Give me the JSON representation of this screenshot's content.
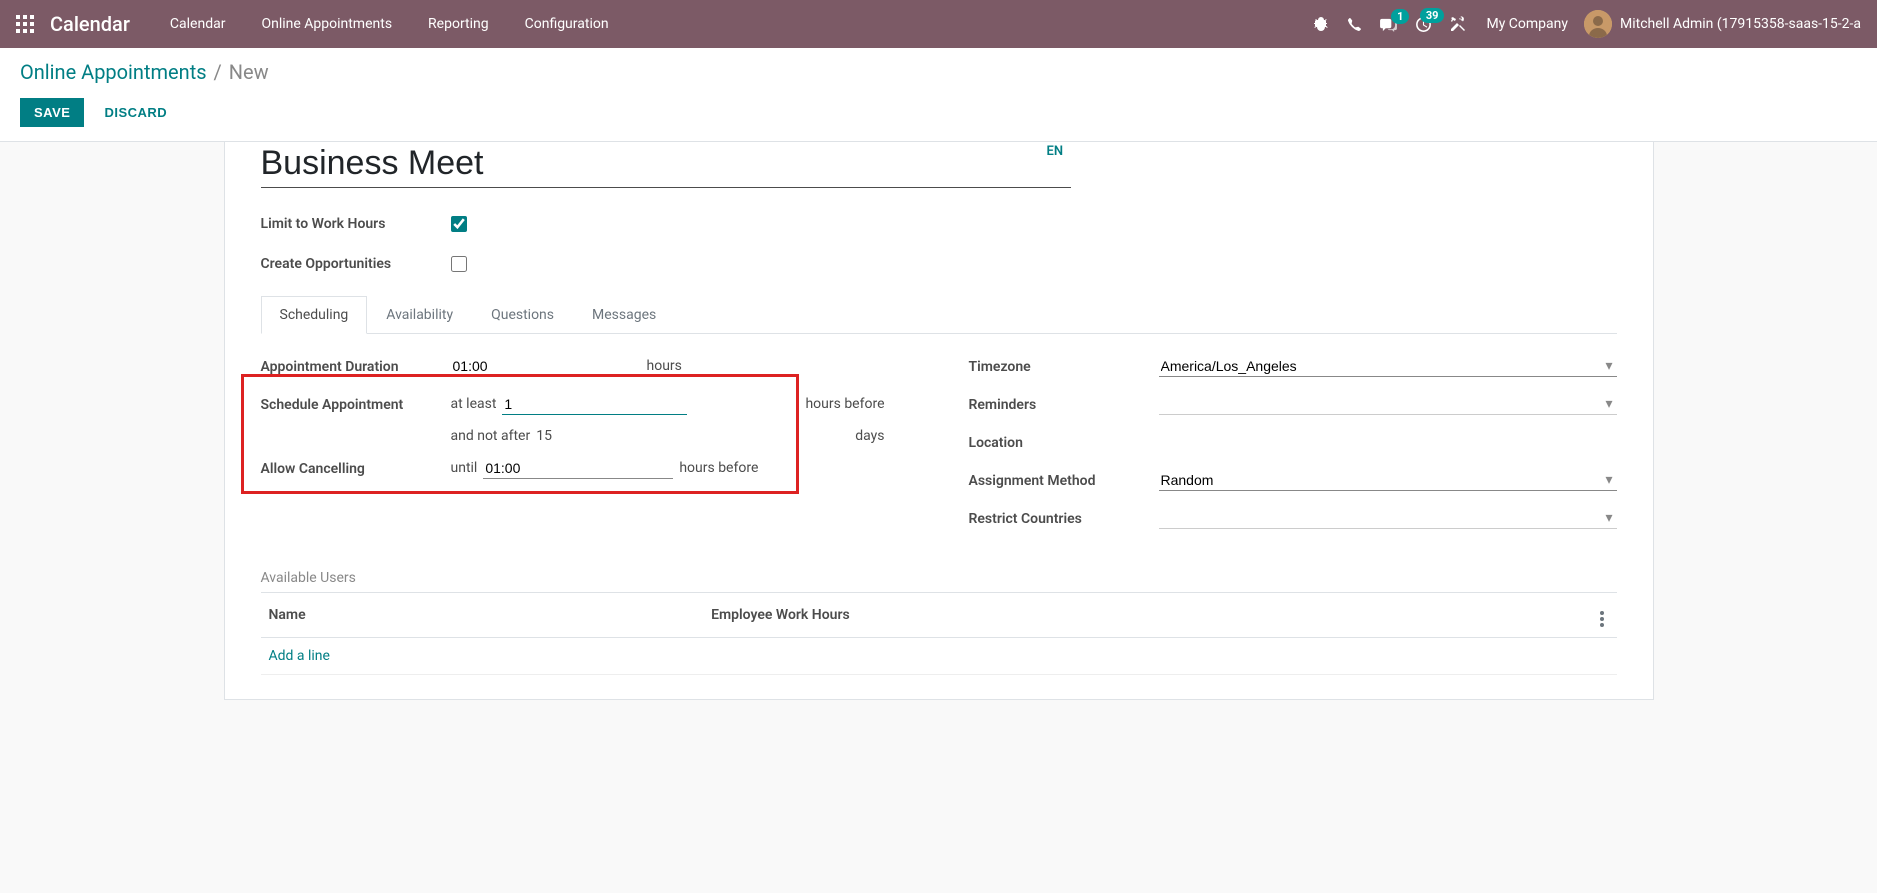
{
  "topnav": {
    "brand": "Calendar",
    "items": [
      "Calendar",
      "Online Appointments",
      "Reporting",
      "Configuration"
    ],
    "chat_badge": "1",
    "activity_badge": "39",
    "company": "My Company",
    "user": "Mitchell Admin (17915358-saas-15-2-a"
  },
  "breadcrumb": {
    "parent": "Online Appointments",
    "current": "New"
  },
  "actions": {
    "save": "SAVE",
    "discard": "DISCARD"
  },
  "form": {
    "name": "Business Meet",
    "lang": "EN",
    "limit_work_hours_label": "Limit to Work Hours",
    "limit_work_hours_checked": true,
    "create_opportunities_label": "Create Opportunities",
    "create_opportunities_checked": false
  },
  "tabs": [
    "Scheduling",
    "Availability",
    "Questions",
    "Messages"
  ],
  "scheduling": {
    "left": {
      "appt_duration_label": "Appointment Duration",
      "appt_duration_value": "01:00",
      "appt_duration_suffix": "hours",
      "schedule_label": "Schedule Appointment",
      "schedule_at_least_prefix": "at least",
      "schedule_at_least_value": "1",
      "schedule_at_least_suffix": "hours before",
      "schedule_not_after_prefix": "and not after",
      "schedule_not_after_value": "15",
      "schedule_not_after_suffix": "days",
      "allow_cancel_label": "Allow Cancelling",
      "allow_cancel_prefix": "until",
      "allow_cancel_value": "01:00",
      "allow_cancel_suffix": "hours before"
    },
    "right": {
      "timezone_label": "Timezone",
      "timezone_value": "America/Los_Angeles",
      "reminders_label": "Reminders",
      "reminders_value": "",
      "location_label": "Location",
      "location_value": "",
      "assignment_label": "Assignment Method",
      "assignment_value": "Random",
      "restrict_label": "Restrict Countries",
      "restrict_value": ""
    }
  },
  "users": {
    "section_title": "Available Users",
    "col_name": "Name",
    "col_hours": "Employee Work Hours",
    "add_line": "Add a line"
  }
}
